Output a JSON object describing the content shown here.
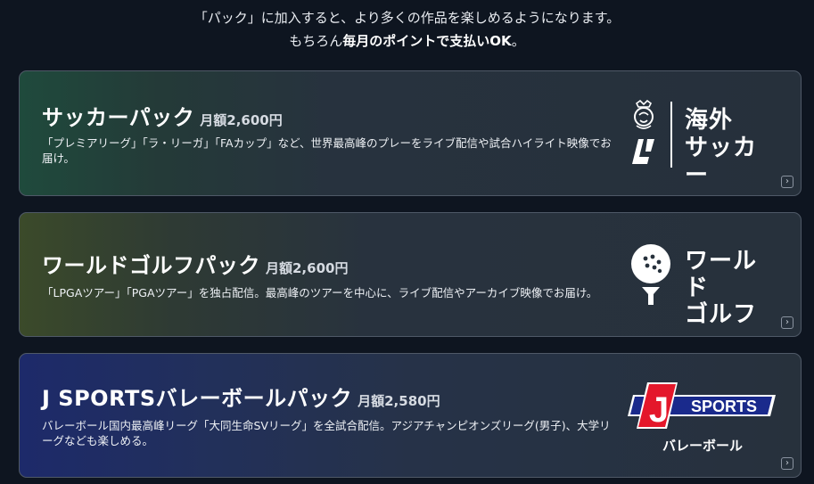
{
  "intro": {
    "line1": "「パック」に加入すると、より多くの作品を楽しめるようになります。",
    "line2_prefix": "もちろん",
    "line2_bold": "毎月のポイントで支払いOK",
    "line2_suffix": "。"
  },
  "packs": [
    {
      "name": "サッカーパック",
      "price": "月額2,600円",
      "description": "「プレミアリーグ」「ラ・リーガ」「FAカップ」など、世界最高峰のプレーをライブ配信や試合ハイライト映像でお届け。",
      "logo_text_1": "海外",
      "logo_text_2": "サッカー",
      "logo_icons": [
        "premier-league-lion-icon",
        "laliga-icon"
      ]
    },
    {
      "name": "ワールドゴルフパック",
      "price": "月額2,600円",
      "description": "「LPGAツアー」「PGAツアー」を独占配信。最高峰のツアーを中心に、ライブ配信やアーカイブ映像でお届け。",
      "logo_text_1": "ワールド",
      "logo_text_2": "ゴルフ",
      "logo_icons": [
        "golf-ball-icon"
      ]
    },
    {
      "name": "J SPORTSバレーボールパック",
      "price": "月額2,580円",
      "description": "バレーボール国内最高峰リーグ「大同生命SVリーグ」を全試合配信。アジアチャンピオンズリーグ(男子)、大学リーグなども楽しめる。",
      "logo_letter": "J",
      "logo_word": "SPORTS",
      "logo_sub": "バレーボール"
    }
  ],
  "chevron_glyph": "›",
  "colors": {
    "background": "#0e1520",
    "card_border": "#4f5967",
    "js_red": "#e4172b",
    "js_blue": "#1a2a8c"
  }
}
